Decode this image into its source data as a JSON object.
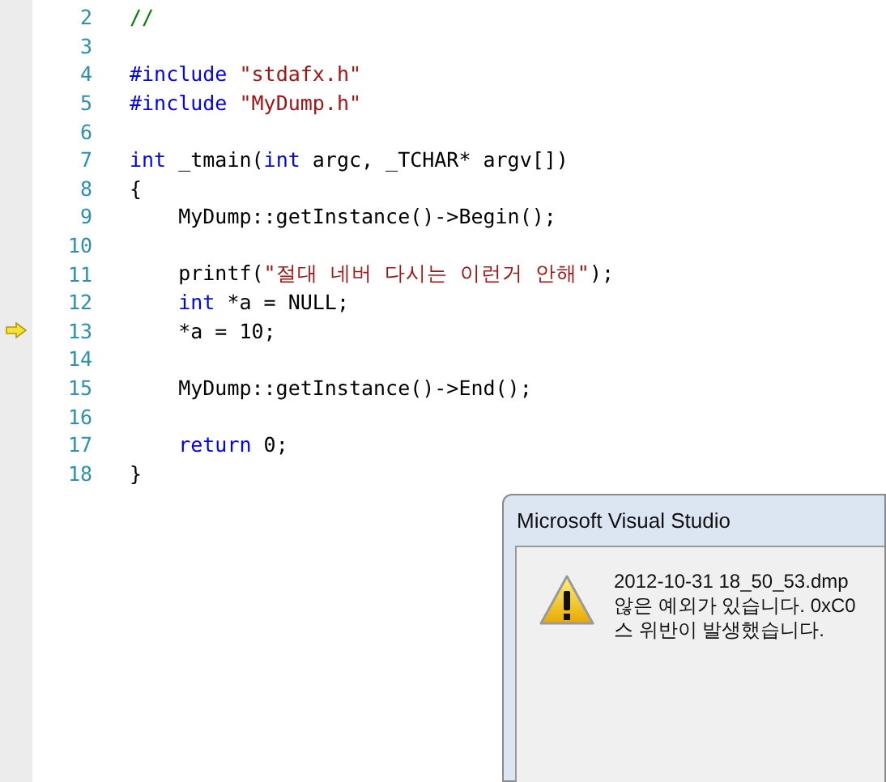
{
  "editor": {
    "lines": [
      {
        "number": "2",
        "current": false,
        "tokens": [
          {
            "kind": "comment",
            "text": "//"
          }
        ]
      },
      {
        "number": "3",
        "current": false
      },
      {
        "number": "4",
        "current": false,
        "tokens": [
          {
            "kind": "keyword",
            "text": "#include"
          },
          {
            "kind": "string",
            "text": " \"stdafx.h\""
          }
        ]
      },
      {
        "number": "5",
        "current": false,
        "tokens": [
          {
            "kind": "keyword",
            "text": "#include"
          },
          {
            "kind": "string",
            "text": " \"MyDump.h\""
          }
        ]
      },
      {
        "number": "6",
        "current": false
      },
      {
        "number": "7",
        "current": false,
        "tokens": [
          {
            "kind": "keyword",
            "text": "int"
          },
          {
            "kind": "plain",
            "text": " _tmain("
          },
          {
            "kind": "keyword",
            "text": "int"
          },
          {
            "kind": "plain",
            "text": " argc, _TCHAR* argv[])"
          }
        ]
      },
      {
        "number": "8",
        "current": false,
        "tokens": [
          {
            "kind": "plain",
            "text": "{"
          }
        ]
      },
      {
        "number": "9",
        "current": false,
        "tokens": [
          {
            "kind": "plain",
            "text": "    MyDump::getInstance()->Begin();"
          }
        ]
      },
      {
        "number": "10",
        "current": false
      },
      {
        "number": "11",
        "current": false,
        "tokens": [
          {
            "kind": "plain",
            "text": "    printf("
          },
          {
            "kind": "string",
            "text": "\"절대 네버 다시는 이런거 안해\""
          },
          {
            "kind": "plain",
            "text": ");"
          }
        ]
      },
      {
        "number": "12",
        "current": false,
        "tokens": [
          {
            "kind": "keyword",
            "text": "    int"
          },
          {
            "kind": "plain",
            "text": " *a = NULL;"
          }
        ]
      },
      {
        "number": "13",
        "current": true,
        "tokens": [
          {
            "kind": "plain",
            "text": "    *a = 10;"
          }
        ]
      },
      {
        "number": "14",
        "current": false
      },
      {
        "number": "15",
        "current": false,
        "tokens": [
          {
            "kind": "plain",
            "text": "    MyDump::getInstance()->End();"
          }
        ]
      },
      {
        "number": "16",
        "current": false
      },
      {
        "number": "17",
        "current": false,
        "tokens": [
          {
            "kind": "keyword",
            "text": "    return"
          },
          {
            "kind": "plain",
            "text": " 0;"
          }
        ]
      },
      {
        "number": "18",
        "current": false,
        "tokens": [
          {
            "kind": "plain",
            "text": "}"
          }
        ]
      }
    ]
  },
  "dialog": {
    "title": "Microsoft Visual Studio",
    "message_lines": [
      "2012-10-31 18_50_53.dmp",
      "않은 예외가 있습니다. 0xC0",
      "스 위반이 발생했습니다."
    ]
  }
}
